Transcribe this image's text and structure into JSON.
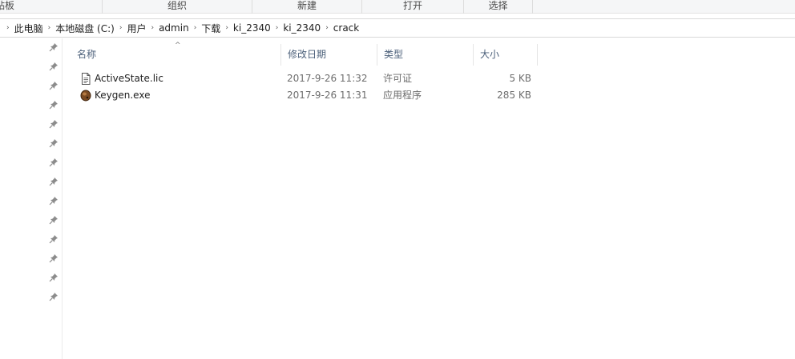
{
  "ribbon": {
    "groups": [
      "贴板",
      "组织",
      "新建",
      "打开",
      "选择"
    ]
  },
  "breadcrumbs": [
    "此电脑",
    "本地磁盘 (C:)",
    "用户",
    "admin",
    "下载",
    "ki_2340",
    "ki_2340",
    "crack"
  ],
  "columns": {
    "name": "名称",
    "date": "修改日期",
    "type": "类型",
    "size": "大小",
    "sort_indicator": "^"
  },
  "files": [
    {
      "name": "ActiveState.lic",
      "date": "2017-9-26 11:32",
      "type": "许可证",
      "size": "5 KB",
      "icon": "document-icon"
    },
    {
      "name": "Keygen.exe",
      "date": "2017-9-26 11:31",
      "type": "应用程序",
      "size": "285 KB",
      "icon": "keygen-app-icon"
    }
  ],
  "navpane": {
    "pin_count": 14,
    "pin_icon": "pin-icon"
  },
  "colors": {
    "header_text": "#4c607a",
    "detail_text": "#6d6d6d",
    "ribbon_bg": "#f5f6f7"
  }
}
